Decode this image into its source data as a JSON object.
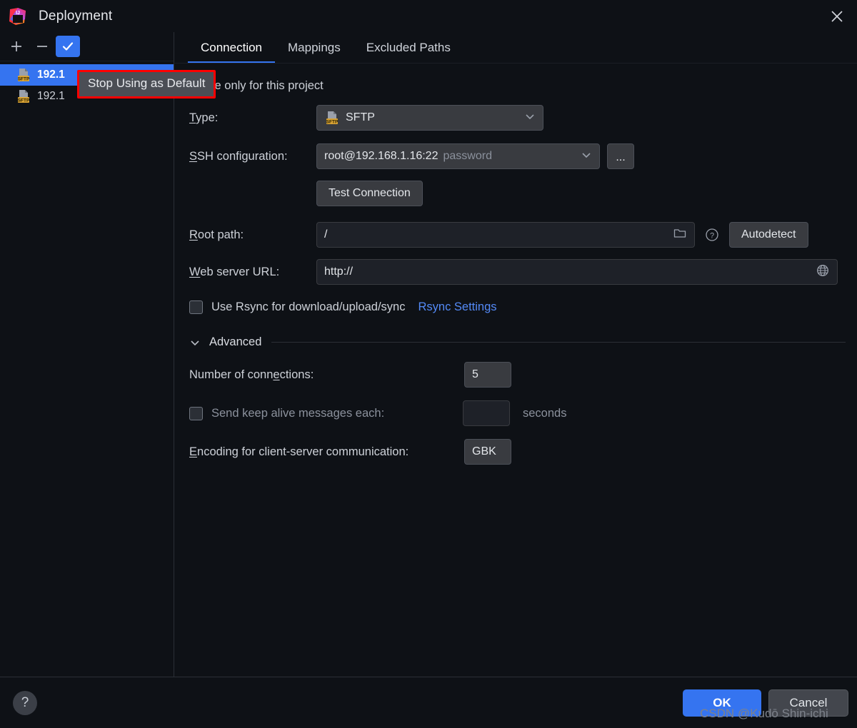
{
  "window": {
    "title": "Deployment",
    "app_icon": "intellij-idea-icon",
    "close_icon": "close-icon"
  },
  "sidebar": {
    "toolbar": [
      {
        "name": "add-server-button",
        "icon": "plus-icon",
        "label": "+",
        "active": false
      },
      {
        "name": "remove-server-button",
        "icon": "minus-icon",
        "label": "−",
        "active": false
      },
      {
        "name": "use-as-default-button",
        "icon": "check-icon",
        "label": "✓",
        "active": true
      }
    ],
    "servers": [
      {
        "label": "192.1",
        "icon": "sftp-icon",
        "selected": true
      },
      {
        "label": "192.1",
        "icon": "sftp-icon",
        "selected": false
      }
    ]
  },
  "tooltip": {
    "text": "Stop Using as Default",
    "border_color": "#ff0000"
  },
  "tabs": [
    {
      "label": "Connection",
      "active": true
    },
    {
      "label": "Mappings",
      "active": false
    },
    {
      "label": "Excluded Paths",
      "active": false
    }
  ],
  "form": {
    "visible_only_checkbox": {
      "label": "ible only for this project",
      "checked": false
    },
    "type": {
      "label_prefix": "T",
      "label_rest": "ype:",
      "value": "SFTP",
      "icon": "sftp-icon",
      "caret": "chevron-down-icon"
    },
    "ssh_configuration": {
      "label_prefix": "S",
      "label_rest": "SH configuration:",
      "value": "root@192.168.1.16:22",
      "value_suffix": "password",
      "browse_label": "...",
      "caret": "chevron-down-icon"
    },
    "test_connection": {
      "label": "Test Connection"
    },
    "root_path": {
      "label_prefix": "R",
      "label_rest": "oot path:",
      "value": "/",
      "folder_icon": "folder-icon",
      "help_icon": "question-circle-icon",
      "autodetect_label": "Autodetect"
    },
    "web_server_url": {
      "label_prefix": "W",
      "label_rest": "eb server URL:",
      "value": "http://",
      "globe_icon": "globe-icon"
    },
    "rsync": {
      "checkbox_label": "Use Rsync for download/upload/sync",
      "checked": false,
      "settings_link": "Rsync Settings",
      "link_color": "#548af7"
    },
    "advanced": {
      "title": "Advanced",
      "chevron": "chevron-down-icon",
      "number_of_connections": {
        "label_prefix": "Number of conn",
        "label_underline": "e",
        "label_suffix": "ctions:",
        "value": "5"
      },
      "keep_alive": {
        "label": "Send keep alive messages each:",
        "checked": false,
        "value": "",
        "unit": "seconds"
      },
      "encoding": {
        "label_prefix": "E",
        "label_rest": "ncoding for client-server communication:",
        "value": "GBK"
      }
    }
  },
  "bottom": {
    "help_icon": "question-mark-icon",
    "ok_label": "OK",
    "cancel_label": "Cancel"
  },
  "watermark": {
    "text": "CSDN @Kudō Shin-ichi"
  },
  "colors": {
    "background": "#0e1116",
    "accent": "#3574f0",
    "field": "#393b40",
    "tooltip_border": "#ff0000"
  }
}
